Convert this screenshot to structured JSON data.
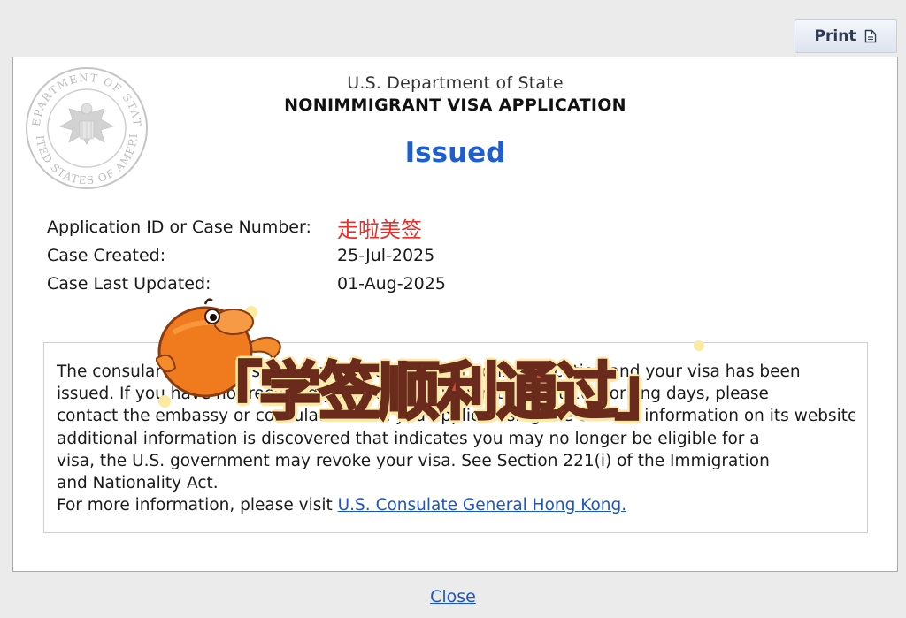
{
  "toolbar": {
    "print_label": "Print"
  },
  "header": {
    "department": "U.S. Department of State",
    "application_type": "NONIMMIGRANT VISA APPLICATION",
    "status": "Issued"
  },
  "seal": {
    "outer_text_top": "DEPARTMENT OF STATE",
    "outer_text_bottom": "UNITED STATES OF AMERICA"
  },
  "case_info": {
    "rows": [
      {
        "label": "Application ID or Case Number:",
        "value": "走啦美签"
      },
      {
        "label": "Case Created:",
        "value": "25-Jul-2025"
      },
      {
        "label": "Case Last Updated:",
        "value": "01-Aug-2025"
      }
    ]
  },
  "message": {
    "line1": "The consular section has completed processing of your application and your visa has been",
    "line2": "issued. If you have not received your passport within the next 10 working days, please",
    "line3": "contact the embassy or consulate where you applied using the contact information on its website. If at any time",
    "line4": "additional information is discovered that indicates you may no longer be eligible for a",
    "line5": "visa, the U.S. government may revoke your visa. See Section 221(i) of the Immigration",
    "line6": "and Nationality Act.",
    "more_info_prefix": "For more information, please visit",
    "link_label": "U.S. Consulate General Hong Kong."
  },
  "overlay": {
    "sticker_text": "「学签顺利通过」"
  },
  "footer": {
    "close_label": "Close"
  },
  "colors": {
    "status_blue": "#1d5fd0",
    "link_blue": "#1d55c8",
    "overlay_red": "#d84a3e",
    "fish_orange": "#f07a1e"
  }
}
